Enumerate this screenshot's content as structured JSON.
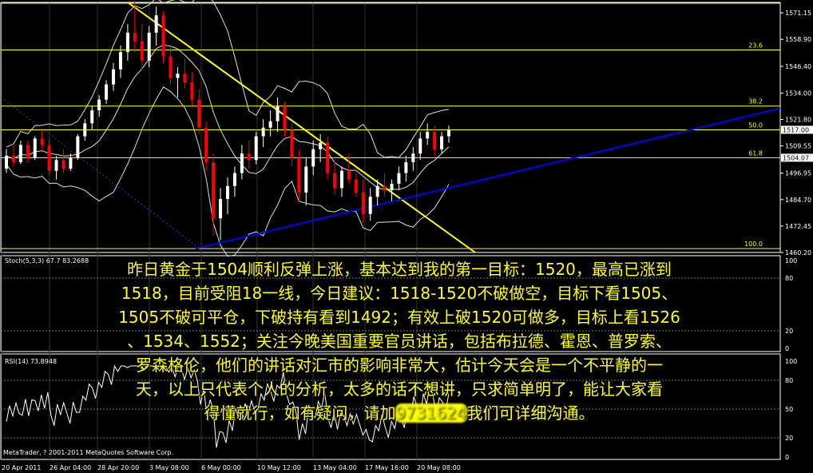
{
  "chart_data": {
    "type": "candlestick",
    "title": "",
    "panels": [
      "price",
      "stochastic",
      "rsi"
    ],
    "price_axis": {
      "ticks": [
        "1571.15",
        "1558.90",
        "1546.40",
        "1534.00",
        "1521.80",
        "1509.55",
        "1496.95",
        "1484.70",
        "1472.45",
        "1460.20"
      ],
      "ylim": [
        1460.2,
        1576
      ]
    },
    "current_price_label": "1517.00",
    "support_price_label": "1504.07",
    "fib_levels": [
      {
        "label": "23.6",
        "price": 1554.0
      },
      {
        "label": "38.2",
        "price": 1528.0
      },
      {
        "label": "50.0",
        "price": 1517.0
      },
      {
        "label": "61.8",
        "price": 1504.07
      },
      {
        "label": "100.0",
        "price": 1462.0
      }
    ],
    "x_ticks": [
      "20 Apr 2011",
      "26 Apr 04:00",
      "28 Apr 20:00",
      "3 May 08:00",
      "6 May 00:00",
      "10 May 12:00",
      "13 May 04:00",
      "17 May 16:00",
      "20 May 08:00"
    ],
    "candles": [
      [
        1499,
        1508,
        1497,
        1505
      ],
      [
        1505,
        1510,
        1500,
        1502
      ],
      [
        1502,
        1512,
        1501,
        1510
      ],
      [
        1510,
        1512,
        1502,
        1504
      ],
      [
        1504,
        1514,
        1503,
        1513
      ],
      [
        1513,
        1517,
        1508,
        1510
      ],
      [
        1510,
        1513,
        1496,
        1498
      ],
      [
        1498,
        1505,
        1494,
        1503
      ],
      [
        1503,
        1508,
        1497,
        1499
      ],
      [
        1499,
        1506,
        1498,
        1504
      ],
      [
        1504,
        1515,
        1503,
        1514
      ],
      [
        1514,
        1522,
        1512,
        1520
      ],
      [
        1520,
        1528,
        1517,
        1526
      ],
      [
        1526,
        1533,
        1523,
        1531
      ],
      [
        1531,
        1540,
        1529,
        1538
      ],
      [
        1538,
        1548,
        1535,
        1545
      ],
      [
        1545,
        1556,
        1541,
        1553
      ],
      [
        1553,
        1566,
        1549,
        1562
      ],
      [
        1562,
        1576,
        1553,
        1558
      ],
      [
        1558,
        1566,
        1545,
        1549
      ],
      [
        1549,
        1565,
        1546,
        1562
      ],
      [
        1562,
        1574,
        1556,
        1570
      ],
      [
        1570,
        1572,
        1548,
        1551
      ],
      [
        1551,
        1556,
        1538,
        1541
      ],
      [
        1541,
        1546,
        1532,
        1543
      ],
      [
        1543,
        1550,
        1536,
        1539
      ],
      [
        1539,
        1544,
        1528,
        1531
      ],
      [
        1531,
        1536,
        1515,
        1518
      ],
      [
        1518,
        1521,
        1498,
        1502
      ],
      [
        1502,
        1506,
        1468,
        1476
      ],
      [
        1476,
        1490,
        1466,
        1485
      ],
      [
        1485,
        1495,
        1478,
        1491
      ],
      [
        1491,
        1500,
        1486,
        1497
      ],
      [
        1497,
        1510,
        1494,
        1506
      ],
      [
        1506,
        1512,
        1499,
        1503
      ],
      [
        1503,
        1516,
        1501,
        1514
      ],
      [
        1514,
        1522,
        1509,
        1518
      ],
      [
        1518,
        1526,
        1514,
        1521
      ],
      [
        1521,
        1532,
        1516,
        1528
      ],
      [
        1528,
        1530,
        1514,
        1517
      ],
      [
        1517,
        1520,
        1500,
        1504
      ],
      [
        1504,
        1508,
        1484,
        1488
      ],
      [
        1488,
        1504,
        1482,
        1500
      ],
      [
        1500,
        1512,
        1496,
        1508
      ],
      [
        1508,
        1515,
        1502,
        1511
      ],
      [
        1511,
        1514,
        1494,
        1497
      ],
      [
        1497,
        1503,
        1487,
        1490
      ],
      [
        1490,
        1500,
        1486,
        1498
      ],
      [
        1498,
        1506,
        1492,
        1494
      ],
      [
        1494,
        1499,
        1486,
        1488
      ],
      [
        1488,
        1494,
        1474,
        1478
      ],
      [
        1478,
        1490,
        1475,
        1486
      ],
      [
        1486,
        1494,
        1482,
        1491
      ],
      [
        1491,
        1497,
        1486,
        1489
      ],
      [
        1489,
        1494,
        1484,
        1492
      ],
      [
        1492,
        1500,
        1489,
        1497
      ],
      [
        1497,
        1505,
        1493,
        1502
      ],
      [
        1502,
        1509,
        1498,
        1506
      ],
      [
        1506,
        1516,
        1503,
        1513
      ],
      [
        1513,
        1520,
        1510,
        1516
      ],
      [
        1516,
        1519,
        1505,
        1508
      ],
      [
        1508,
        1516,
        1506,
        1514
      ],
      [
        1514,
        1519,
        1511,
        1517
      ]
    ],
    "stoch_label": "Stoch(5,3,3) 67.7  83.2688",
    "stoch_ticks": [
      "100",
      "80",
      "20",
      "0"
    ],
    "rsi_label": "RSI(14) 73.8948",
    "rsi_ticks": [
      "100",
      "80",
      "50",
      "20",
      "0"
    ]
  },
  "overlay_text": {
    "line1": "昨日黄金于1504顺利反弹上涨，基本达到我的第一目标：1520，最高已涨到",
    "line2": "1518，目前受阻18一线，今日建议：1518-1520不破做空，目标下看1505、",
    "line3": "1505不破可平仓，下破持有看到1492；有效上破1520可做多，目标上看1526",
    "line4": "、1534、1552；关注今晚美国重要官员讲话，包括布拉德、霍恩、普罗索、",
    "line5": "罗森格伦，他们的讲话对汇市的影响非常大，估计今天会是一个不平静的一",
    "line6": "天，以上只代表个人的分析，太多的话不想讲，只求简单明了，能让大家看",
    "line7_before": "得懂就行，如有疑问，请加",
    "line7_blurred": "9731624",
    "line7_after": "我们可详细沟通。"
  },
  "footer": {
    "copyright": "MetaTrader, ? 2001-2011 MetaQuotes Software Corp."
  },
  "colors": {
    "background": "#000000",
    "frame": "#ffffff",
    "fib": "#ffff00",
    "trend_down": "#ffff00",
    "trend_up": "#0000ff",
    "bull": "#ffffff",
    "bear": "#ff0000",
    "text_overlay": "#ffff00"
  }
}
